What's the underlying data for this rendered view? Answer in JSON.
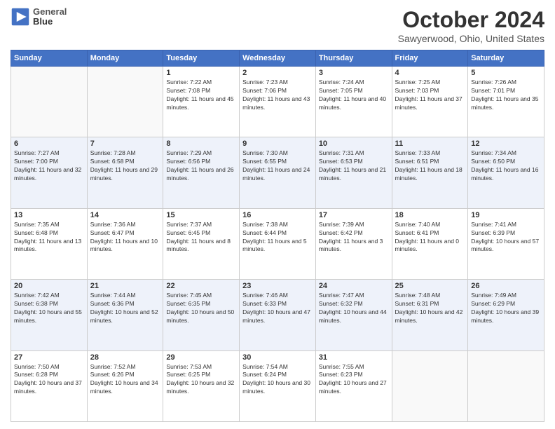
{
  "header": {
    "logo_line1": "General",
    "logo_line2": "Blue",
    "month": "October 2024",
    "location": "Sawyerwood, Ohio, United States"
  },
  "weekdays": [
    "Sunday",
    "Monday",
    "Tuesday",
    "Wednesday",
    "Thursday",
    "Friday",
    "Saturday"
  ],
  "rows": [
    [
      {
        "day": "",
        "empty": true
      },
      {
        "day": "",
        "empty": true
      },
      {
        "day": "1",
        "sunrise": "Sunrise: 7:22 AM",
        "sunset": "Sunset: 7:08 PM",
        "daylight": "Daylight: 11 hours and 45 minutes."
      },
      {
        "day": "2",
        "sunrise": "Sunrise: 7:23 AM",
        "sunset": "Sunset: 7:06 PM",
        "daylight": "Daylight: 11 hours and 43 minutes."
      },
      {
        "day": "3",
        "sunrise": "Sunrise: 7:24 AM",
        "sunset": "Sunset: 7:05 PM",
        "daylight": "Daylight: 11 hours and 40 minutes."
      },
      {
        "day": "4",
        "sunrise": "Sunrise: 7:25 AM",
        "sunset": "Sunset: 7:03 PM",
        "daylight": "Daylight: 11 hours and 37 minutes."
      },
      {
        "day": "5",
        "sunrise": "Sunrise: 7:26 AM",
        "sunset": "Sunset: 7:01 PM",
        "daylight": "Daylight: 11 hours and 35 minutes."
      }
    ],
    [
      {
        "day": "6",
        "sunrise": "Sunrise: 7:27 AM",
        "sunset": "Sunset: 7:00 PM",
        "daylight": "Daylight: 11 hours and 32 minutes."
      },
      {
        "day": "7",
        "sunrise": "Sunrise: 7:28 AM",
        "sunset": "Sunset: 6:58 PM",
        "daylight": "Daylight: 11 hours and 29 minutes."
      },
      {
        "day": "8",
        "sunrise": "Sunrise: 7:29 AM",
        "sunset": "Sunset: 6:56 PM",
        "daylight": "Daylight: 11 hours and 26 minutes."
      },
      {
        "day": "9",
        "sunrise": "Sunrise: 7:30 AM",
        "sunset": "Sunset: 6:55 PM",
        "daylight": "Daylight: 11 hours and 24 minutes."
      },
      {
        "day": "10",
        "sunrise": "Sunrise: 7:31 AM",
        "sunset": "Sunset: 6:53 PM",
        "daylight": "Daylight: 11 hours and 21 minutes."
      },
      {
        "day": "11",
        "sunrise": "Sunrise: 7:33 AM",
        "sunset": "Sunset: 6:51 PM",
        "daylight": "Daylight: 11 hours and 18 minutes."
      },
      {
        "day": "12",
        "sunrise": "Sunrise: 7:34 AM",
        "sunset": "Sunset: 6:50 PM",
        "daylight": "Daylight: 11 hours and 16 minutes."
      }
    ],
    [
      {
        "day": "13",
        "sunrise": "Sunrise: 7:35 AM",
        "sunset": "Sunset: 6:48 PM",
        "daylight": "Daylight: 11 hours and 13 minutes."
      },
      {
        "day": "14",
        "sunrise": "Sunrise: 7:36 AM",
        "sunset": "Sunset: 6:47 PM",
        "daylight": "Daylight: 11 hours and 10 minutes."
      },
      {
        "day": "15",
        "sunrise": "Sunrise: 7:37 AM",
        "sunset": "Sunset: 6:45 PM",
        "daylight": "Daylight: 11 hours and 8 minutes."
      },
      {
        "day": "16",
        "sunrise": "Sunrise: 7:38 AM",
        "sunset": "Sunset: 6:44 PM",
        "daylight": "Daylight: 11 hours and 5 minutes."
      },
      {
        "day": "17",
        "sunrise": "Sunrise: 7:39 AM",
        "sunset": "Sunset: 6:42 PM",
        "daylight": "Daylight: 11 hours and 3 minutes."
      },
      {
        "day": "18",
        "sunrise": "Sunrise: 7:40 AM",
        "sunset": "Sunset: 6:41 PM",
        "daylight": "Daylight: 11 hours and 0 minutes."
      },
      {
        "day": "19",
        "sunrise": "Sunrise: 7:41 AM",
        "sunset": "Sunset: 6:39 PM",
        "daylight": "Daylight: 10 hours and 57 minutes."
      }
    ],
    [
      {
        "day": "20",
        "sunrise": "Sunrise: 7:42 AM",
        "sunset": "Sunset: 6:38 PM",
        "daylight": "Daylight: 10 hours and 55 minutes."
      },
      {
        "day": "21",
        "sunrise": "Sunrise: 7:44 AM",
        "sunset": "Sunset: 6:36 PM",
        "daylight": "Daylight: 10 hours and 52 minutes."
      },
      {
        "day": "22",
        "sunrise": "Sunrise: 7:45 AM",
        "sunset": "Sunset: 6:35 PM",
        "daylight": "Daylight: 10 hours and 50 minutes."
      },
      {
        "day": "23",
        "sunrise": "Sunrise: 7:46 AM",
        "sunset": "Sunset: 6:33 PM",
        "daylight": "Daylight: 10 hours and 47 minutes."
      },
      {
        "day": "24",
        "sunrise": "Sunrise: 7:47 AM",
        "sunset": "Sunset: 6:32 PM",
        "daylight": "Daylight: 10 hours and 44 minutes."
      },
      {
        "day": "25",
        "sunrise": "Sunrise: 7:48 AM",
        "sunset": "Sunset: 6:31 PM",
        "daylight": "Daylight: 10 hours and 42 minutes."
      },
      {
        "day": "26",
        "sunrise": "Sunrise: 7:49 AM",
        "sunset": "Sunset: 6:29 PM",
        "daylight": "Daylight: 10 hours and 39 minutes."
      }
    ],
    [
      {
        "day": "27",
        "sunrise": "Sunrise: 7:50 AM",
        "sunset": "Sunset: 6:28 PM",
        "daylight": "Daylight: 10 hours and 37 minutes."
      },
      {
        "day": "28",
        "sunrise": "Sunrise: 7:52 AM",
        "sunset": "Sunset: 6:26 PM",
        "daylight": "Daylight: 10 hours and 34 minutes."
      },
      {
        "day": "29",
        "sunrise": "Sunrise: 7:53 AM",
        "sunset": "Sunset: 6:25 PM",
        "daylight": "Daylight: 10 hours and 32 minutes."
      },
      {
        "day": "30",
        "sunrise": "Sunrise: 7:54 AM",
        "sunset": "Sunset: 6:24 PM",
        "daylight": "Daylight: 10 hours and 30 minutes."
      },
      {
        "day": "31",
        "sunrise": "Sunrise: 7:55 AM",
        "sunset": "Sunset: 6:23 PM",
        "daylight": "Daylight: 10 hours and 27 minutes."
      },
      {
        "day": "",
        "empty": true
      },
      {
        "day": "",
        "empty": true
      }
    ]
  ]
}
